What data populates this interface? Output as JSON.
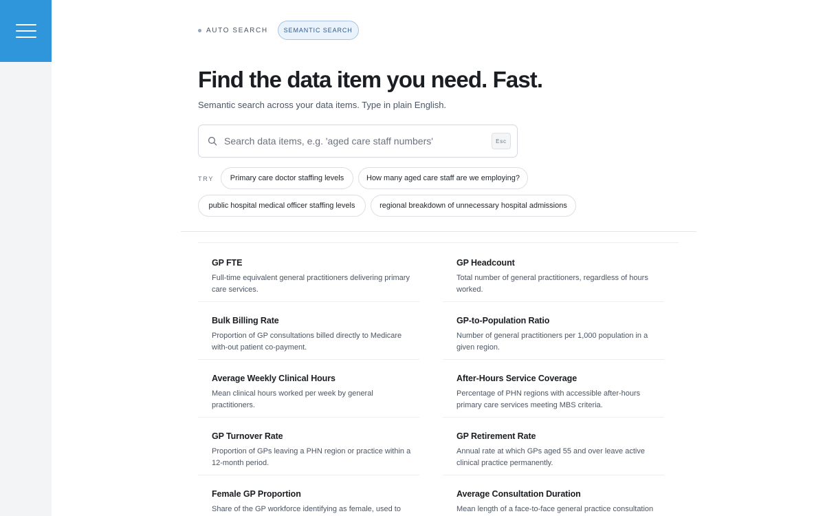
{
  "nav": {
    "menu_icon": "hamburger-menu-icon"
  },
  "modes": {
    "auto_label": "AUTO SEARCH",
    "semantic_label": "SEMANTIC SEARCH",
    "active": "SEMANTIC SEARCH"
  },
  "header": {
    "title": "Find the data item you need. Fast.",
    "subtitle": "Semantic search across your data items. Type in plain English."
  },
  "search": {
    "placeholder": "Search data items, e.g. 'aged care staff numbers'",
    "value": "",
    "icon": "search-icon",
    "esc_label": "Esc"
  },
  "suggestions": {
    "label": "TRY",
    "chips": [
      "Primary care doctor staffing levels",
      "How many aged care staff are we employing?",
      "public hospital medical officer staffing levels",
      "regional breakdown of unnecessary hospital admissions"
    ]
  },
  "results": [
    {
      "title": "GP FTE",
      "description": "Full-time equivalent general practitioners delivering primary care services."
    },
    {
      "title": "GP Headcount",
      "description": "Total number of general practitioners, regardless of hours worked."
    },
    {
      "title": "Bulk Billing Rate",
      "description": "Proportion of GP consultations billed directly to Medicare with-out patient co-payment."
    },
    {
      "title": "GP-to-Population Ratio",
      "description": "Number of general practitioners per 1,000 population in a given region."
    },
    {
      "title": "Average Weekly Clinical Hours",
      "description": "Mean clinical hours worked per week by general practitioners."
    },
    {
      "title": "After-Hours Service Coverage",
      "description": "Percentage of PHN regions with accessible after-hours primary care services meeting MBS criteria."
    },
    {
      "title": "GP Turnover Rate",
      "description": "Proportion of GPs leaving a PHN region or practice within a 12-month period."
    },
    {
      "title": "GP Retirement Rate",
      "description": "Annual rate at which GPs aged 55 and over leave active clinical practice permanently."
    },
    {
      "title": "Female GP Proportion",
      "description": "Share of the GP workforce identifying as female, used to model"
    },
    {
      "title": "Average Consultation Duration",
      "description": "Mean length of a face-to-face general practice consultation in"
    }
  ],
  "colors": {
    "accent": "#2f96dc",
    "chip_active_bg": "#eaf2fb",
    "chip_active_border": "#a9c4e2"
  }
}
